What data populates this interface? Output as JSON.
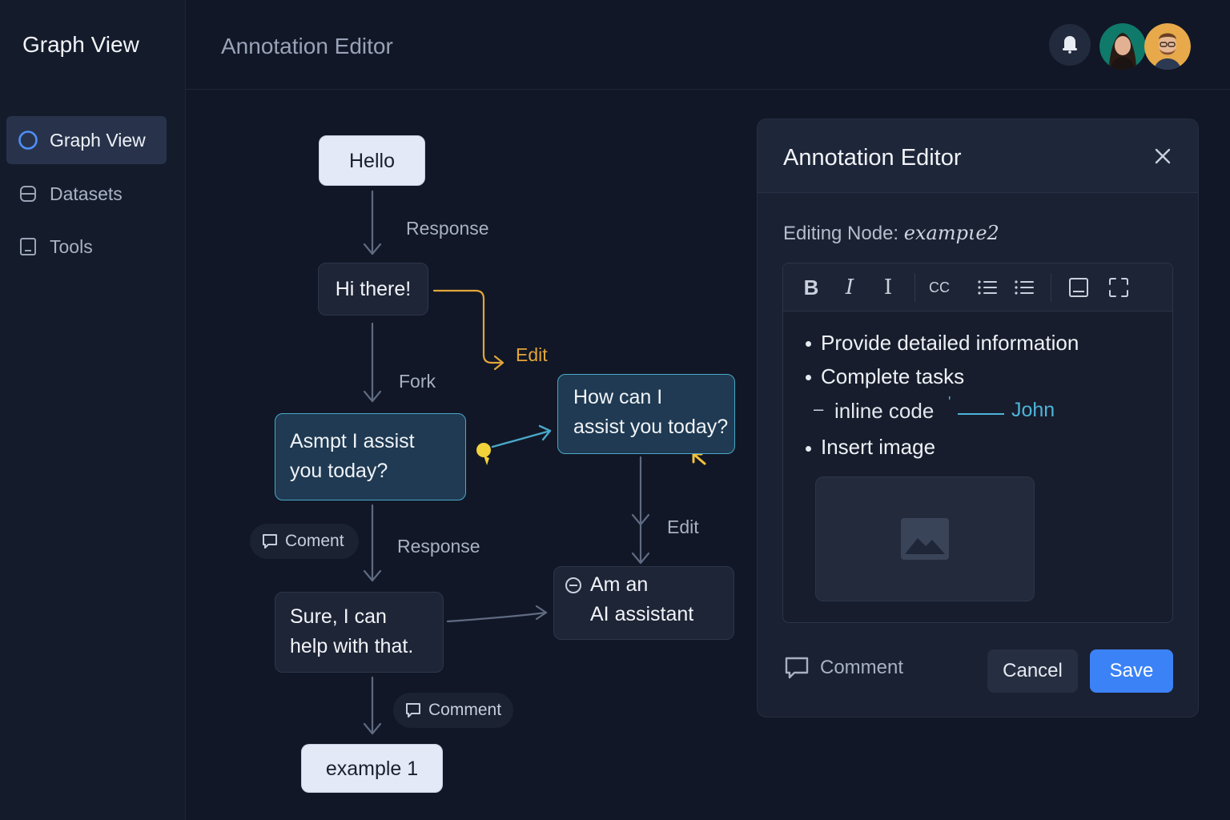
{
  "sidebar": {
    "brand": "Graph View",
    "items": [
      {
        "label": "Graph View",
        "icon": "circle-icon",
        "active": true
      },
      {
        "label": "Datasets",
        "icon": "database-icon",
        "active": false
      },
      {
        "label": "Tools",
        "icon": "panel-icon",
        "active": false
      }
    ]
  },
  "header": {
    "title": "Annotation Editor",
    "icons": [
      "bell-icon",
      "avatar-woman",
      "avatar-man"
    ]
  },
  "graph": {
    "nodes": {
      "hello": "Hello",
      "hi_there": "Hi there!",
      "asmpt_line1": "Asmpt I assist",
      "asmpt_line2": "you today?",
      "howcan_line1": "How can I",
      "howcan_line2": "assist you today?",
      "sure_line1": "Sure, I can",
      "sure_line2": "help with that.",
      "aman_line1": "Am an",
      "aman_line2": "AI assistant",
      "example1": "example 1"
    },
    "edge_labels": {
      "response1": "Response",
      "edit1": "Edit",
      "fork": "Fork",
      "response2": "Response",
      "edit2": "Edit"
    },
    "comment_pills": {
      "coment": "Coment",
      "comment": "Comment"
    },
    "colors": {
      "edge": "#5f6b82",
      "edit_edge": "#e3a53a",
      "link_edge": "#4aa7c8",
      "marker": "#f2d23b"
    }
  },
  "panel": {
    "title": "Annotation Editor",
    "editing_label": "Editing Node:",
    "editing_node": "exampιe2",
    "toolbar": {
      "bold": "B",
      "italic": "I",
      "text": "I",
      "cc": "CC",
      "icons": [
        "bold-icon",
        "italic-icon",
        "text-cursor-icon",
        "cc-icon",
        "ordered-list-icon",
        "bullet-list-icon",
        "image-frame-icon",
        "fullscreen-icon"
      ]
    },
    "content": {
      "bullet1": "Provide detailed information",
      "bullet2": "Complete tasks",
      "dash": "–",
      "inline_code": "inline code",
      "tick": "'",
      "mention": "John",
      "bullet3": "Insert image"
    },
    "footer": {
      "comment": "Comment",
      "cancel": "Cancel",
      "save": "Save"
    },
    "colors": {
      "save_button": "#3b82f6",
      "mention": "#4fb3d9"
    }
  }
}
